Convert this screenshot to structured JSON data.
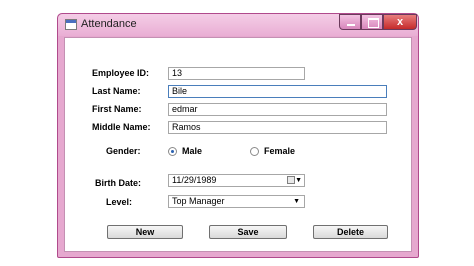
{
  "window": {
    "title": "Attendance",
    "close_glyph": "x"
  },
  "form": {
    "employee_id": {
      "label": "Employee ID:",
      "value": "13"
    },
    "last_name": {
      "label": "Last Name:",
      "value": "Bile"
    },
    "first_name": {
      "label": "First Name:",
      "value": "edmar"
    },
    "middle_name": {
      "label": "Middle Name:",
      "value": "Ramos"
    },
    "gender": {
      "label": "Gender:",
      "options": [
        "Male",
        "Female"
      ],
      "selected": "Male"
    },
    "birth_date": {
      "label": "Birth Date:",
      "value": "11/29/1989"
    },
    "level": {
      "label": "Level:",
      "value": "Top Manager"
    }
  },
  "buttons": {
    "new": "New",
    "save": "Save",
    "delete": "Delete"
  },
  "icons": {
    "app": "form-icon",
    "calendar": "calendar-icon",
    "dropdown": "chevron-down-icon"
  },
  "colors": {
    "frame": "#e6a8cf",
    "close": "#c52a2a",
    "focus": "#4a7ebb"
  }
}
